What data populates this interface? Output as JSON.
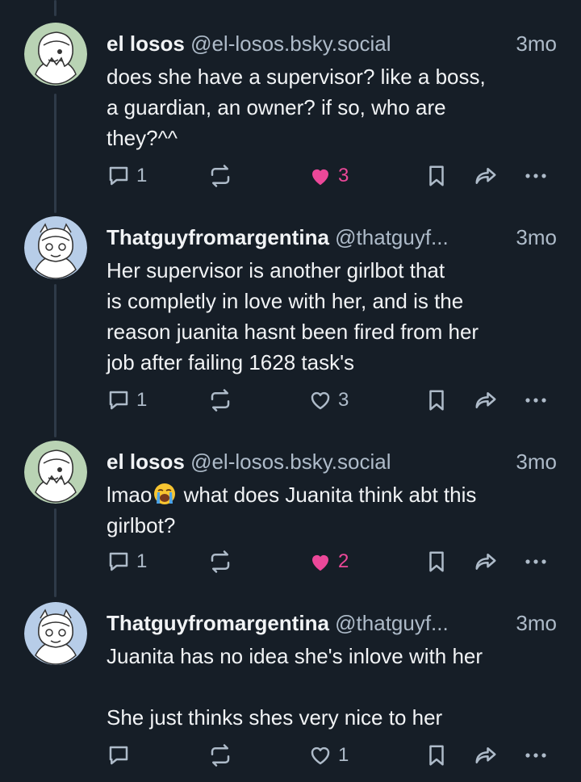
{
  "posts": [
    {
      "author_name": "el losos",
      "author_handle": "@el-losos.bsky.social",
      "time": "3mo",
      "avatar": "green-avatar",
      "text": "does she have a supervisor? like a boss,\na guardian, an owner? if so, who are\nthey?^^",
      "replies": "1",
      "likes": "3",
      "liked": true
    },
    {
      "author_name": "Thatguyfromargentina",
      "author_handle": "@thatguyf...",
      "time": "3mo",
      "avatar": "blue-avatar",
      "text": "Her supervisor is another girlbot that\nis completly in love with her, and is the\nreason juanita hasnt been fired from her\njob after failing 1628 task's",
      "replies": "1",
      "likes": "3",
      "liked": false
    },
    {
      "author_name": "el losos",
      "author_handle": "@el-losos.bsky.social",
      "time": "3mo",
      "avatar": "green-avatar",
      "text_before_emoji": "lmao",
      "text_after_emoji": " what does Juanita think abt this\ngirlbot?",
      "emoji": "loudly-crying-face",
      "replies": "1",
      "likes": "2",
      "liked": true
    },
    {
      "author_name": "Thatguyfromargentina",
      "author_handle": "@thatguyf...",
      "time": "3mo",
      "avatar": "blue-avatar",
      "text": "Juanita has no idea she's inlove with her\n\nShe just thinks shes very nice to her",
      "replies": "",
      "likes": "1",
      "liked": false
    }
  ],
  "colors": {
    "background": "#161e27",
    "like_active": "#ec4899",
    "muted_text": "#aebbc9",
    "thread_line": "#2e3a48"
  }
}
